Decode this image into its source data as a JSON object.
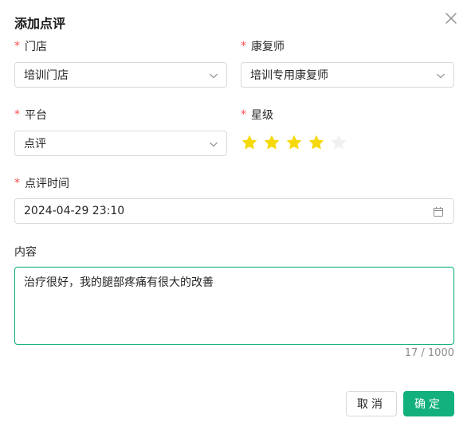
{
  "dialog": {
    "title": "添加点评"
  },
  "fields": {
    "store": {
      "label": "门店",
      "value": "培训门店"
    },
    "therapist": {
      "label": "康复师",
      "value": "培训专用康复师"
    },
    "platform": {
      "label": "平台",
      "value": "点评"
    },
    "rating": {
      "label": "星级",
      "value": 4,
      "max": 5
    },
    "review_time": {
      "label": "点评时间",
      "value": "2024-04-29 23:10"
    },
    "content": {
      "label": "内容",
      "value": "治疗很好，我的腿部疼痛有很大的改善",
      "count": "17 / 1000"
    }
  },
  "required_mark": "*",
  "actions": {
    "cancel_label": "取消",
    "confirm_label": "确定"
  },
  "colors": {
    "accent": "#12b07c",
    "required": "#ff4d4f",
    "star_filled": "#f5d90a",
    "star_empty": "#f0f0f0"
  },
  "icons": {
    "close": "close-icon",
    "select_arrow": "chevron-down-icon",
    "date": "calendar-icon",
    "rating": "star-icon"
  }
}
